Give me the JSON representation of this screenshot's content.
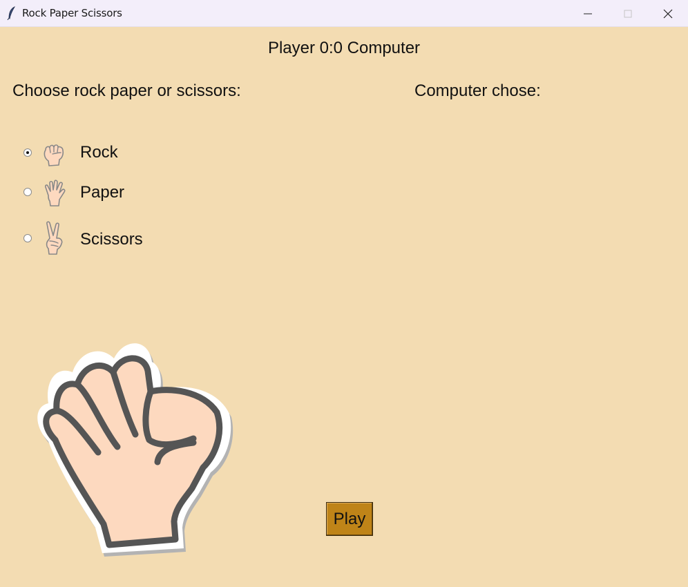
{
  "window": {
    "title": "Rock Paper Scissors",
    "icon": "feather-icon",
    "controls": [
      "minimize-icon",
      "maximize-icon",
      "close-icon"
    ]
  },
  "score": "Player 0:0 Computer",
  "prompt": "Choose rock paper or scissors:",
  "computer_label": "Computer chose:",
  "options": [
    {
      "label": "Rock",
      "icon": "rock-hand-icon",
      "checked": true
    },
    {
      "label": "Paper",
      "icon": "paper-hand-icon",
      "checked": false
    },
    {
      "label": "Scissors",
      "icon": "scissors-hand-icon",
      "checked": false
    }
  ],
  "selected_choice_image": "rock-fist-icon",
  "play_label": "Play",
  "colors": {
    "background": "#f3dcb2",
    "titlebar": "#f3eefa",
    "play_button": "#bf8418",
    "skin": "#fdd9bf",
    "outline": "#555555"
  }
}
